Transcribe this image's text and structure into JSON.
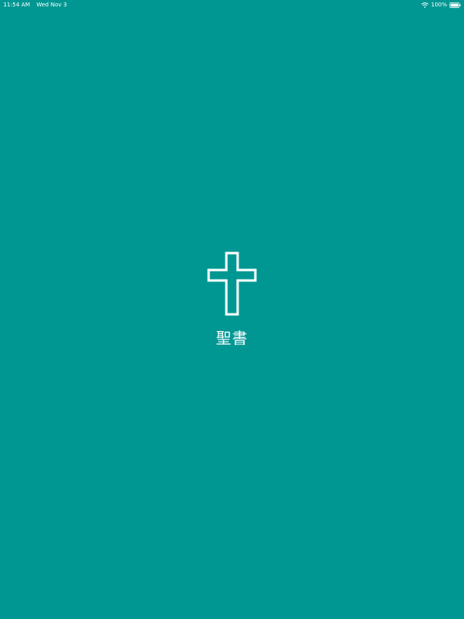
{
  "status_bar": {
    "time": "11:54 AM",
    "date": "Wed Nov 3",
    "battery_percent": "100%",
    "wifi_icon": "wifi-icon",
    "battery_icon": "battery-icon",
    "battery_level": 1.0
  },
  "splash": {
    "icon": "cross-icon",
    "title": "聖書"
  },
  "colors": {
    "background": "#009793",
    "foreground": "#ffffff"
  }
}
